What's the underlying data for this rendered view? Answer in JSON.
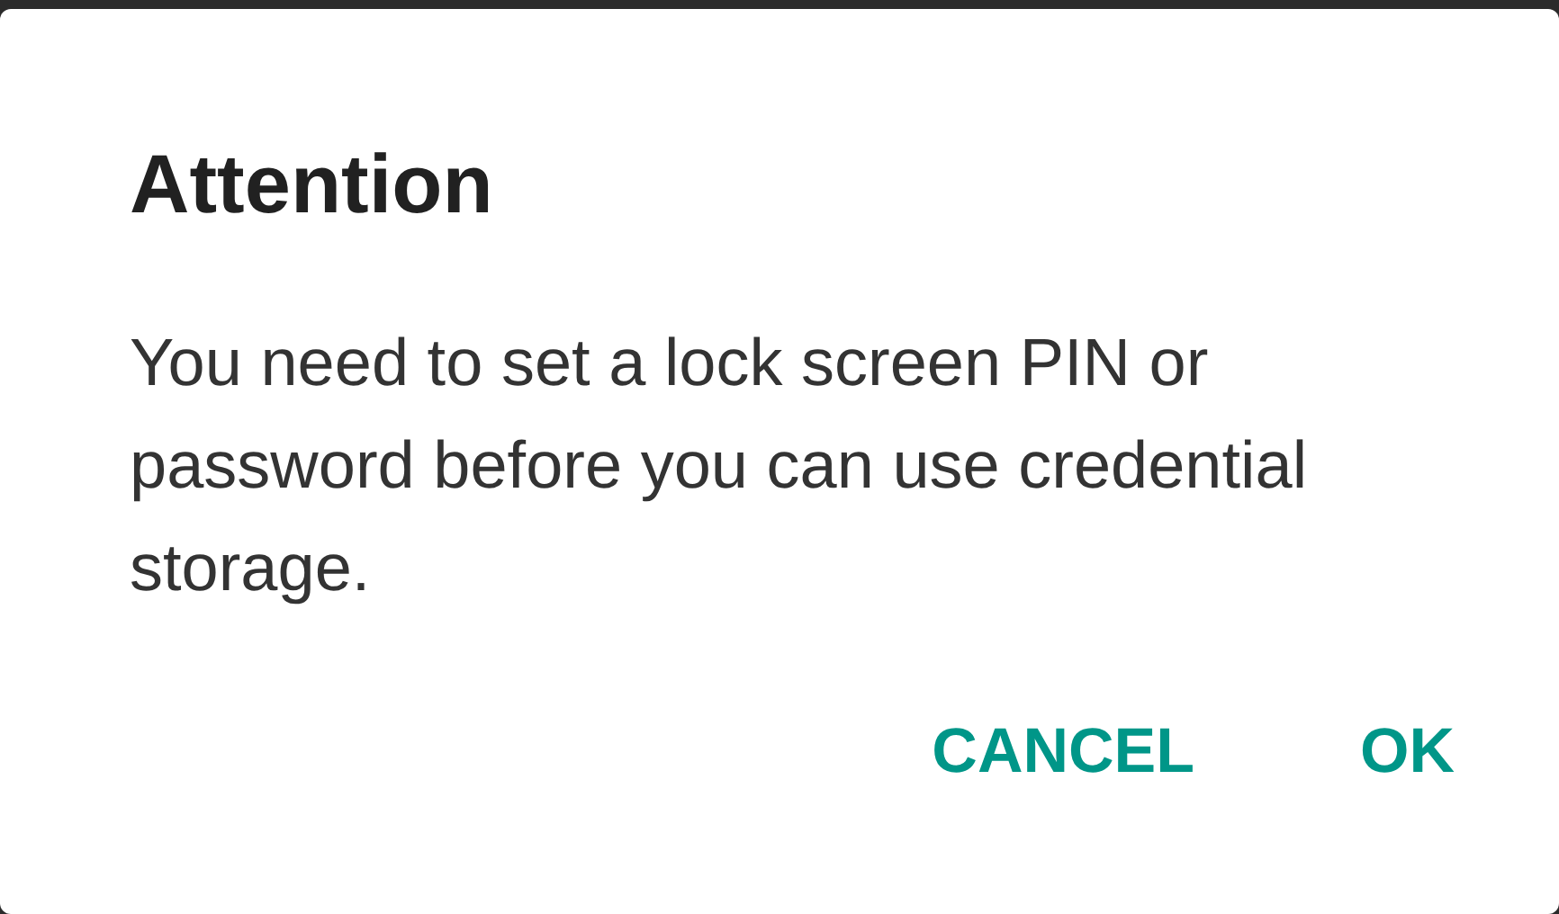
{
  "dialog": {
    "title": "Attention",
    "message": "You need to set a lock screen PIN or password before you can use credential storage.",
    "buttons": [
      {
        "label": "CANCEL"
      },
      {
        "label": "OK"
      }
    ]
  }
}
